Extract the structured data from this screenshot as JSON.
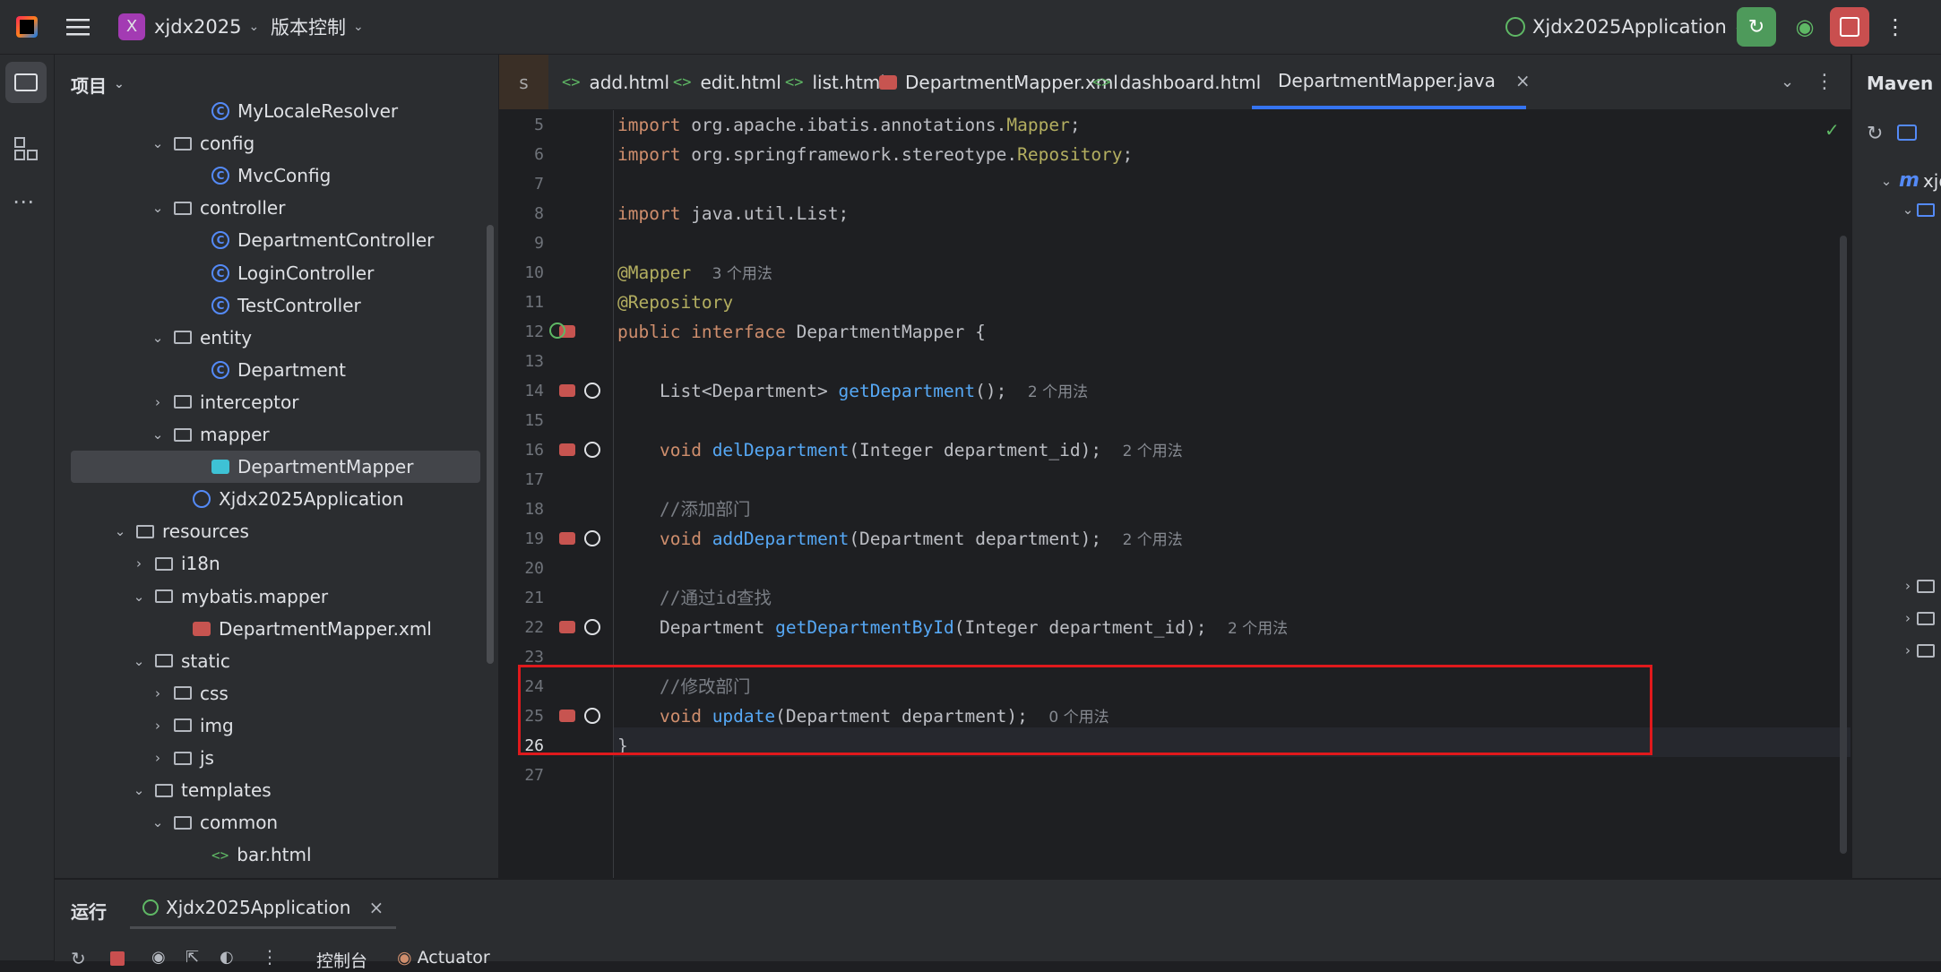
{
  "topbar": {
    "project_letter": "X",
    "project_name": "xjdx2025",
    "vcs_label": "版本控制",
    "run_config": "Xjdx2025Application"
  },
  "project_panel": {
    "title": "项目",
    "tree": [
      {
        "label": "MyLocaleResolver",
        "type": "class",
        "indent": 7,
        "arrow": ""
      },
      {
        "label": "config",
        "type": "folder",
        "indent": 5,
        "arrow": "open"
      },
      {
        "label": "MvcConfig",
        "type": "class",
        "indent": 7,
        "arrow": ""
      },
      {
        "label": "controller",
        "type": "folder",
        "indent": 5,
        "arrow": "open"
      },
      {
        "label": "DepartmentController",
        "type": "class",
        "indent": 7,
        "arrow": ""
      },
      {
        "label": "LoginController",
        "type": "class",
        "indent": 7,
        "arrow": ""
      },
      {
        "label": "TestController",
        "type": "class",
        "indent": 7,
        "arrow": ""
      },
      {
        "label": "entity",
        "type": "folder",
        "indent": 5,
        "arrow": "open"
      },
      {
        "label": "Department",
        "type": "class",
        "indent": 7,
        "arrow": ""
      },
      {
        "label": "interceptor",
        "type": "folder",
        "indent": 5,
        "arrow": "closed"
      },
      {
        "label": "mapper",
        "type": "folder",
        "indent": 5,
        "arrow": "open"
      },
      {
        "label": "DepartmentMapper",
        "type": "mapper",
        "indent": 7,
        "arrow": "",
        "selected": true
      },
      {
        "label": "Xjdx2025Application",
        "type": "app",
        "indent": 6,
        "arrow": ""
      },
      {
        "label": "resources",
        "type": "folder",
        "indent": 3,
        "arrow": "open"
      },
      {
        "label": "i18n",
        "type": "folder",
        "indent": 4,
        "arrow": "closed"
      },
      {
        "label": "mybatis.mapper",
        "type": "folder",
        "indent": 4,
        "arrow": "open"
      },
      {
        "label": "DepartmentMapper.xml",
        "type": "xml",
        "indent": 6,
        "arrow": ""
      },
      {
        "label": "static",
        "type": "folder",
        "indent": 4,
        "arrow": "open"
      },
      {
        "label": "css",
        "type": "folder",
        "indent": 5,
        "arrow": "closed"
      },
      {
        "label": "img",
        "type": "folder",
        "indent": 5,
        "arrow": "closed"
      },
      {
        "label": "js",
        "type": "folder",
        "indent": 5,
        "arrow": "closed"
      },
      {
        "label": "templates",
        "type": "folder",
        "indent": 4,
        "arrow": "open"
      },
      {
        "label": "common",
        "type": "folder",
        "indent": 5,
        "arrow": "open"
      },
      {
        "label": "bar.html",
        "type": "html",
        "indent": 7,
        "arrow": ""
      }
    ]
  },
  "tabs": [
    {
      "label": "s",
      "icon": ""
    },
    {
      "label": "add.html",
      "icon": "<>"
    },
    {
      "label": "edit.html",
      "icon": "<>"
    },
    {
      "label": "list.html",
      "icon": "<>"
    },
    {
      "label": "DepartmentMapper.xml",
      "icon": "xml"
    },
    {
      "label": "dashboard.html",
      "icon": "<>"
    },
    {
      "label": "DepartmentMapper.java",
      "icon": "mapper",
      "active": true,
      "close": "×"
    }
  ],
  "editor": {
    "lines": [
      {
        "n": "5",
        "html": "<span class=\"kw\">import</span> org.apache.ibatis.annotations.<span class=\"ann\">Mapper</span>;"
      },
      {
        "n": "6",
        "html": "<span class=\"kw\">import</span> org.springframework.stereotype.<span class=\"ann\">Repository</span>;"
      },
      {
        "n": "7",
        "html": ""
      },
      {
        "n": "8",
        "html": "<span class=\"kw\">import</span> java.util.List;"
      },
      {
        "n": "9",
        "html": ""
      },
      {
        "n": "10",
        "html": "<span class=\"ann\">@Mapper</span>  <span class=\"hint\">3 个用法</span>"
      },
      {
        "n": "11",
        "html": "<span class=\"ann\">@Repository</span>"
      },
      {
        "n": "12",
        "html": "<span class=\"kw\">public interface</span> DepartmentMapper {"
      },
      {
        "n": "13",
        "html": ""
      },
      {
        "n": "14",
        "html": "    List&lt;Department&gt; <span class=\"fn\">getDepartment</span>();  <span class=\"hint\">2 个用法</span>"
      },
      {
        "n": "15",
        "html": ""
      },
      {
        "n": "16",
        "html": "    <span class=\"kw\">void</span> <span class=\"fn\">delDepartment</span>(Integer department_id);  <span class=\"hint\">2 个用法</span>"
      },
      {
        "n": "17",
        "html": ""
      },
      {
        "n": "18",
        "html": "    <span class=\"cm\">//添加部门</span>"
      },
      {
        "n": "19",
        "html": "    <span class=\"kw\">void</span> <span class=\"fn\">addDepartment</span>(Department department);  <span class=\"hint\">2 个用法</span>"
      },
      {
        "n": "20",
        "html": ""
      },
      {
        "n": "21",
        "html": "    <span class=\"cm\">//通过id查找</span>"
      },
      {
        "n": "22",
        "html": "    Department <span class=\"fn\">getDepartmentById</span>(Integer department_id);  <span class=\"hint\">2 个用法</span>"
      },
      {
        "n": "23",
        "html": ""
      },
      {
        "n": "24",
        "html": "    <span class=\"cm\">//修改部门</span>"
      },
      {
        "n": "25",
        "html": "    <span class=\"kw\">void</span> <span class=\"fn\">update</span>(Department department);  <span class=\"hint\">0 个用法</span>"
      },
      {
        "n": "26",
        "html": "}"
      },
      {
        "n": "27",
        "html": ""
      }
    ]
  },
  "maven": {
    "title": "Maven",
    "root": "xjd"
  },
  "bottom": {
    "run_label": "运行",
    "run_tab": "Xjdx2025Application",
    "console_label": "控制台",
    "actuator_label": "Actuator"
  },
  "colors": {
    "accent": "#3574f0",
    "highlight_box": "#e0191c",
    "run_green": "#4e9a5b",
    "stop_red": "#c94f4f"
  }
}
